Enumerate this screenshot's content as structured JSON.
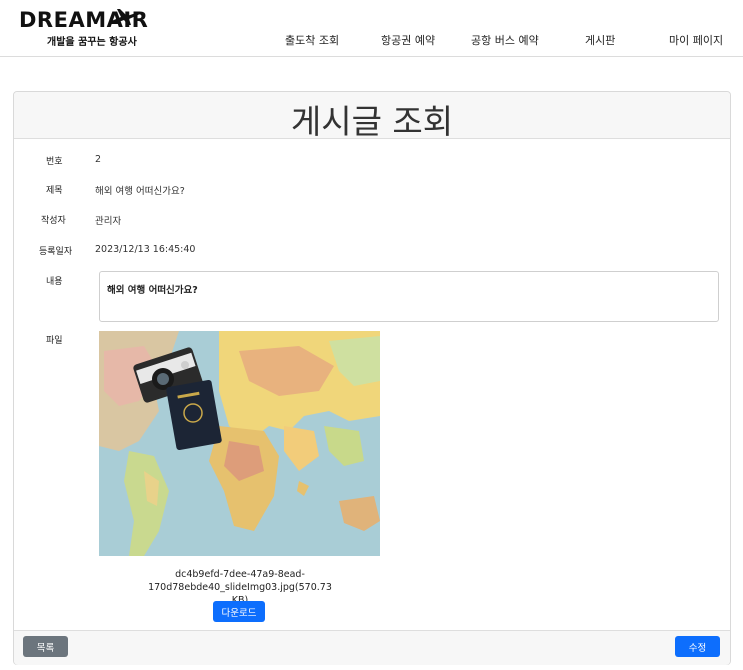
{
  "header": {
    "logo_text": "DREAMAIR",
    "logo_tagline": "개발을 꿈꾸는 항공사",
    "nav": [
      "출도착 조회",
      "항공권 예약",
      "공항 버스 예약",
      "게시판",
      "마이 페이지"
    ]
  },
  "page": {
    "title": "게시글 조회"
  },
  "post": {
    "labels": {
      "number": "번호",
      "subject": "제목",
      "author": "작성자",
      "date": "등록일자",
      "content": "내용",
      "file": "파일"
    },
    "number": "2",
    "subject": "해외 여행 어떠신가요?",
    "author": "관리자",
    "date": "2023/12/13 16:45:40",
    "content": "해외 여행 어떠신가요?",
    "file": {
      "name_line1": "dc4b9efd-7dee-47a9-8ead-170d78ebde40_slideImg03.jpg(570.73",
      "name_line2": "KB)",
      "image_icon": "world-map-camera-passport-photo",
      "download_label": "다운로드"
    }
  },
  "footer": {
    "list_label": "목록",
    "edit_label": "수정"
  },
  "colors": {
    "primary": "#0d6efd",
    "secondary": "#6c757d"
  }
}
